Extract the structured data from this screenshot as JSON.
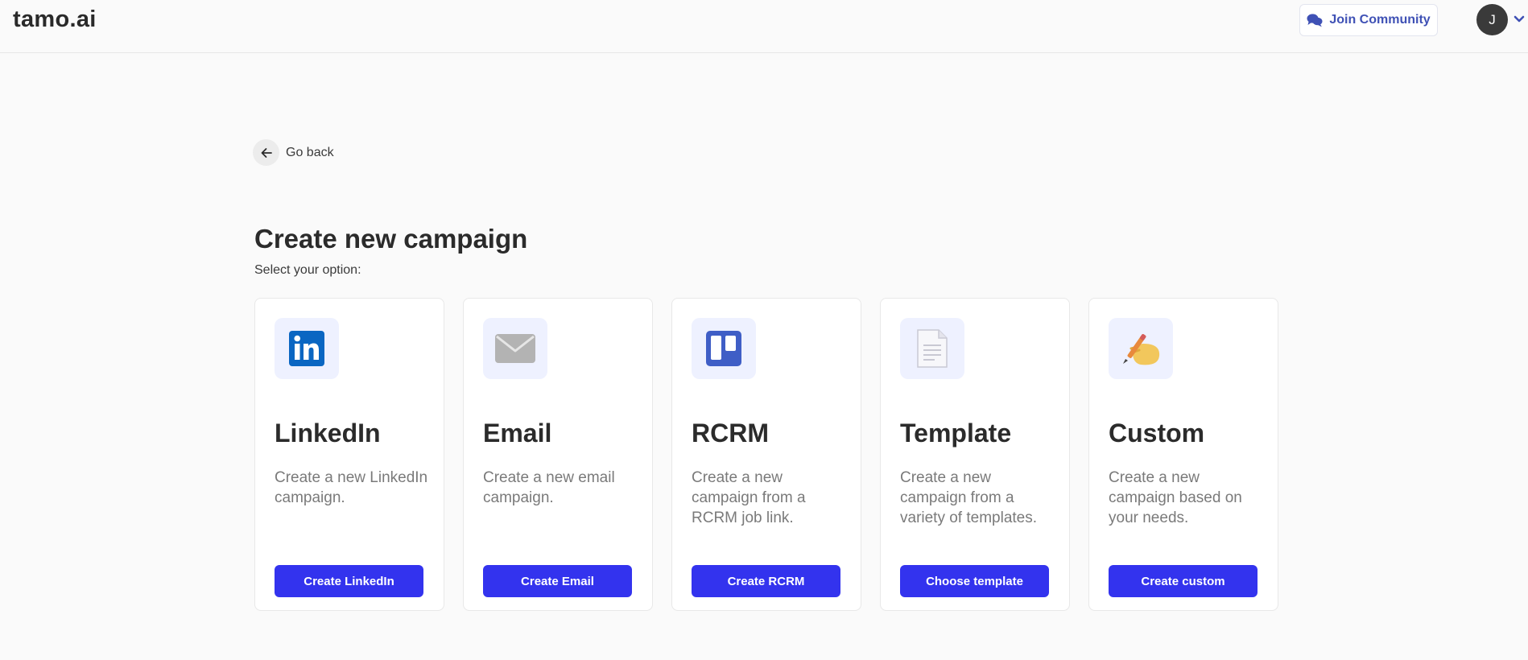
{
  "header": {
    "brand": "tamo.ai",
    "community_label": "Join Community",
    "avatar_initial": "J"
  },
  "nav": {
    "go_back_label": "Go back"
  },
  "main": {
    "title": "Create new campaign",
    "subtitle": "Select your option:"
  },
  "cards": [
    {
      "title": "LinkedIn",
      "description": "Create a new LinkedIn campaign.",
      "button": "Create LinkedIn",
      "icon": "linkedin-icon"
    },
    {
      "title": "Email",
      "description": "Create a new email campaign.",
      "button": "Create Email",
      "icon": "envelope-icon"
    },
    {
      "title": "RCRM",
      "description": "Create a new campaign from a RCRM job link.",
      "button": "Create RCRM",
      "icon": "board-icon"
    },
    {
      "title": "Template",
      "description": "Create a new campaign from a variety of templates.",
      "button": "Choose template",
      "icon": "document-icon"
    },
    {
      "title": "Custom",
      "description": "Create a new campaign based on your needs.",
      "button": "Create custom",
      "icon": "writing-hand-icon"
    }
  ],
  "colors": {
    "accent": "#3333ee",
    "community_text": "#3f51b5",
    "icon_bg": "#eef1ff",
    "linkedin": "#0a66c2",
    "rcrm": "#3f5ec6"
  }
}
